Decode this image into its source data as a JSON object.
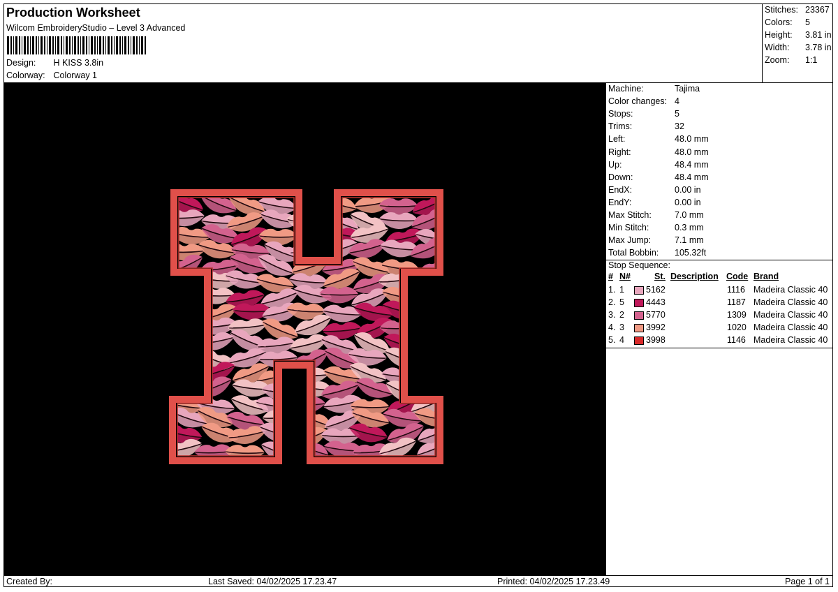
{
  "header": {
    "title": "Production Worksheet",
    "software": "Wilcom EmbroideryStudio – Level 3 Advanced",
    "design_label": "Design:",
    "design_value": "H KISS 3.8in",
    "colorway_label": "Colorway:",
    "colorway_value": "Colorway 1"
  },
  "stats": {
    "stitches_label": "Stitches:",
    "stitches_value": "23367",
    "colors_label": "Colors:",
    "colors_value": "5",
    "height_label": "Height:",
    "height_value": "3.81 in",
    "width_label": "Width:",
    "width_value": "3.78 in",
    "zoom_label": "Zoom:",
    "zoom_value": "1:1"
  },
  "machine_info": [
    {
      "label": "Machine:",
      "value": "Tajima"
    },
    {
      "label": "Color changes:",
      "value": "4"
    },
    {
      "label": "Stops:",
      "value": "5"
    },
    {
      "label": "Trims:",
      "value": "32"
    },
    {
      "label": "Left:",
      "value": "48.0 mm"
    },
    {
      "label": "Right:",
      "value": "48.0 mm"
    },
    {
      "label": "Up:",
      "value": "48.4 mm"
    },
    {
      "label": "Down:",
      "value": "48.4 mm"
    },
    {
      "label": "EndX:",
      "value": "0.00 in"
    },
    {
      "label": "EndY:",
      "value": "0.00 in"
    },
    {
      "label": "Max Stitch:",
      "value": "7.0 mm"
    },
    {
      "label": "Min Stitch:",
      "value": "0.3 mm"
    },
    {
      "label": "Max Jump:",
      "value": "7.1 mm"
    },
    {
      "label": "Total Bobbin:",
      "value": "105.32ft"
    }
  ],
  "stop_sequence": {
    "title": "Stop Sequence:",
    "headers": {
      "index": "#",
      "n": "N#",
      "st": "St.",
      "description": "Description",
      "code": "Code",
      "brand": "Brand"
    },
    "rows": [
      {
        "index": "1.",
        "n": "1",
        "color": "#e8a6bd",
        "st": "5162",
        "code": "1116",
        "brand": "Madeira Classic 40"
      },
      {
        "index": "2.",
        "n": "5",
        "color": "#c0185a",
        "st": "4443",
        "code": "1187",
        "brand": "Madeira Classic 40"
      },
      {
        "index": "3.",
        "n": "2",
        "color": "#d3628e",
        "st": "5770",
        "code": "1309",
        "brand": "Madeira Classic 40"
      },
      {
        "index": "4.",
        "n": "3",
        "color": "#f09a84",
        "st": "3992",
        "code": "1020",
        "brand": "Madeira Classic 40"
      },
      {
        "index": "5.",
        "n": "4",
        "color": "#d92a2a",
        "st": "3998",
        "code": "1146",
        "brand": "Madeira Classic 40"
      }
    ]
  },
  "footer": {
    "created_by": "Created By:",
    "last_saved": "Last Saved: 04/02/2025 17.23.47",
    "printed": "Printed: 04/02/2025 17.23.49",
    "page": "Page 1 of 1"
  },
  "colors": {
    "outline": "#e0504a",
    "lips": [
      "#e8a6bd",
      "#c0185a",
      "#d3628e",
      "#f09a84",
      "#f2c2c4"
    ]
  }
}
